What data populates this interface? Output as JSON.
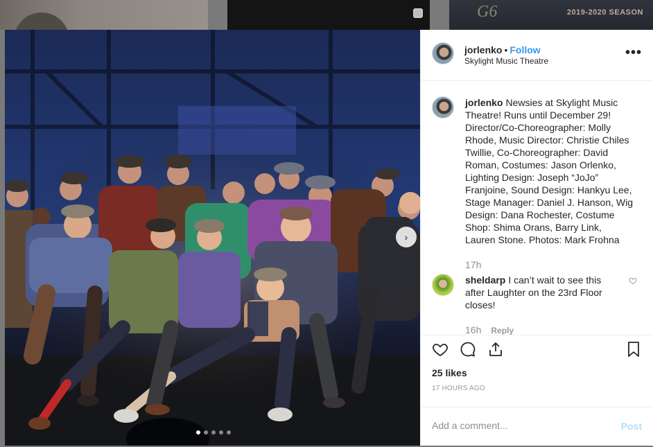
{
  "background": {
    "tile3_logo": "G6",
    "tile3_season": "2019-2020 SEASON"
  },
  "post": {
    "username": "jorlenko",
    "follow_label": "Follow",
    "location": "Skylight Music Theatre",
    "more_icon": "more-horizontal-icon",
    "carousel_count": 5,
    "carousel_active": 0
  },
  "comments": [
    {
      "username": "jorlenko",
      "text": "Newsies at Skylight Music Theatre! Runs until December 29! Director/Co-Choreographer: Molly Rhode, Music Director: Christie Chiles Twillie, Co-Choreographer: David Roman, Costumes: Jason Orlenko, Lighting Design: Joseph “JoJo” Franjoine, Sound Design: Hankyu Lee, Stage Manager: Daniel J. Hanson, Wig Design: Dana Rochester, Costume Shop: Shima Orans, Barry Link, Lauren Stone. Photos: Mark Frohna",
      "time": "17h"
    },
    {
      "username": "sheldarp",
      "text": "I can’t wait to see this after Laughter on the 23rd Floor closes!",
      "time": "16h",
      "reply_label": "Reply"
    }
  ],
  "actions": {
    "likes": "25 likes",
    "timestamp": "17 HOURS AGO"
  },
  "composer": {
    "placeholder": "Add a comment...",
    "post_label": "Post"
  },
  "colors": {
    "link_blue": "#3897f0",
    "post_disabled": "#b2dffc",
    "meta_gray": "#8e8e8e"
  }
}
